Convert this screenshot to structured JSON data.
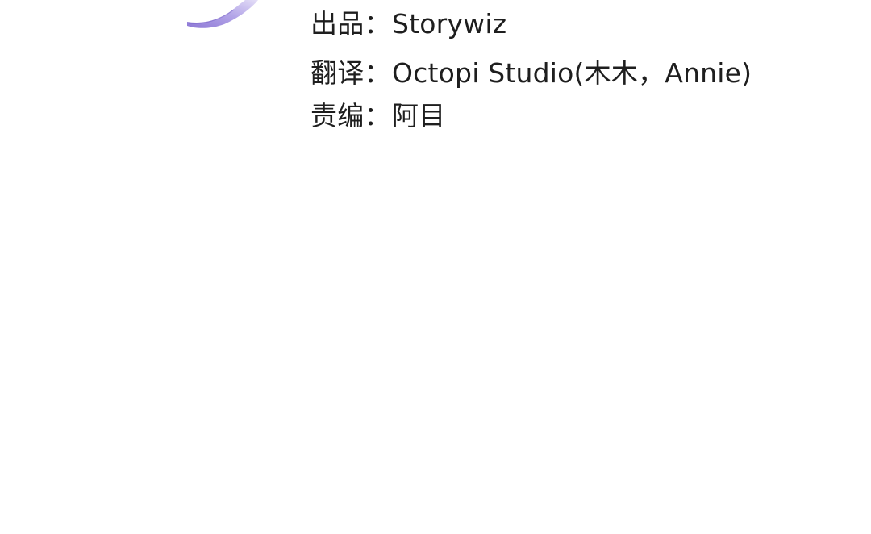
{
  "illustration": {
    "icon": "feather-icon",
    "color_light": "#d9d2f2",
    "color_dark": "#8e79d6"
  },
  "credits": [
    {
      "label": "出品：",
      "value": "Storywiz"
    },
    {
      "label": "翻译：",
      "value": "Octopi Studio(木木，Annie)"
    },
    {
      "label": "责编：",
      "value": "阿目"
    }
  ]
}
